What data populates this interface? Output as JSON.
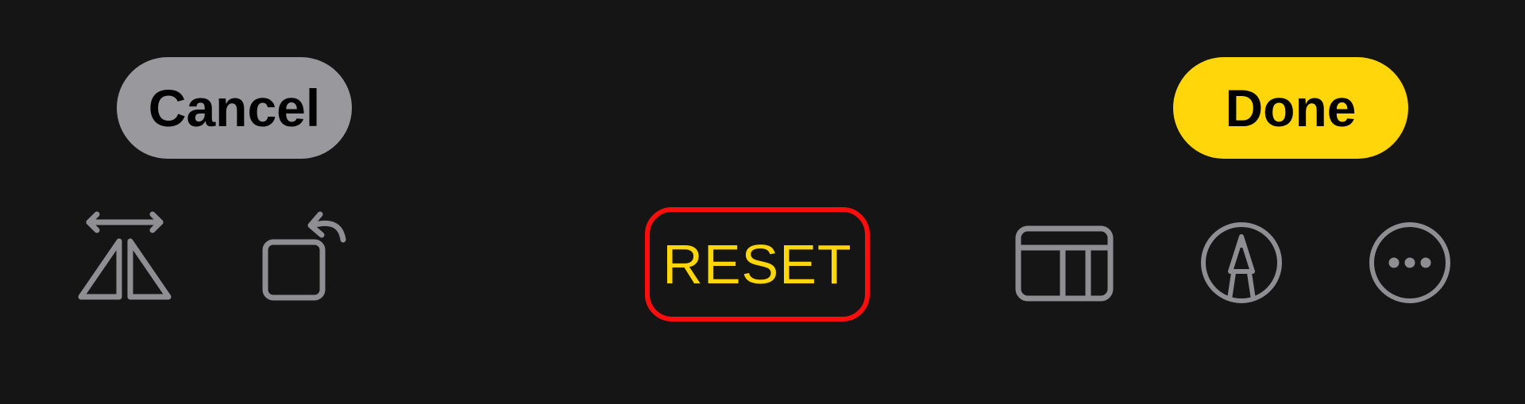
{
  "header": {
    "cancel_label": "Cancel",
    "done_label": "Done"
  },
  "toolbar": {
    "reset_label": "RESET",
    "icons": [
      "flip-horizontal-icon",
      "rotate-icon",
      "aspect-ratio-icon",
      "markup-pen-icon",
      "more-options-icon"
    ]
  },
  "colors": {
    "background": "#151515",
    "cancel_bg": "#98989d",
    "accent": "#ffd60a",
    "icon_gray": "#8e8e93",
    "highlight_red": "#ff0d0d"
  }
}
